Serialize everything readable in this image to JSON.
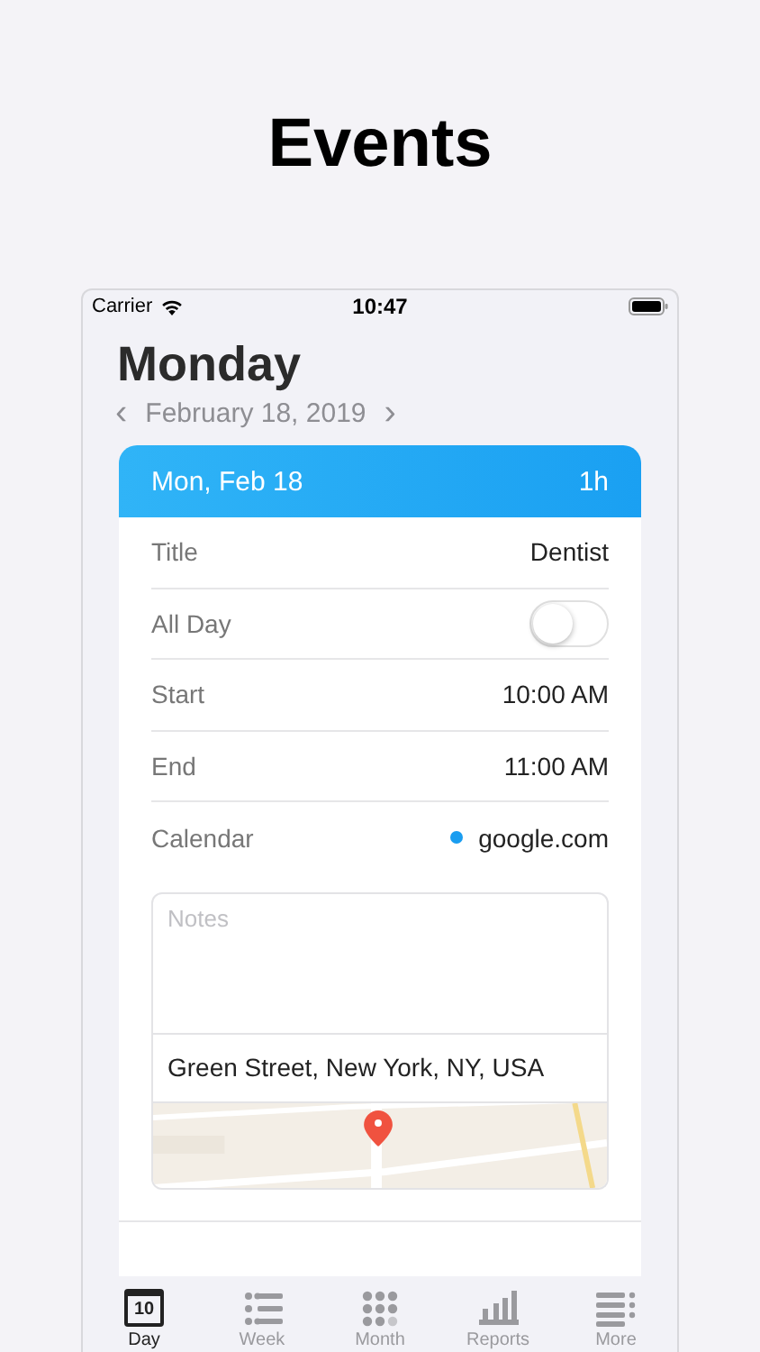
{
  "headline": "Events",
  "status_bar": {
    "carrier": "Carrier",
    "time": "10:47"
  },
  "day_title": "Monday",
  "date_nav": {
    "prev": "‹",
    "date": "February 18, 2019",
    "next": "›"
  },
  "event": {
    "header_date": "Mon, Feb 18",
    "header_duration": "1h",
    "rows": [
      {
        "kind": "text",
        "label": "Title",
        "value": "Dentist"
      },
      {
        "kind": "toggle",
        "label": "All Day",
        "on": false
      },
      {
        "kind": "text",
        "label": "Start",
        "value": "10:00 AM"
      },
      {
        "kind": "text",
        "label": "End",
        "value": "11:00 AM"
      },
      {
        "kind": "calendar",
        "label": "Calendar",
        "value": "google.com",
        "color": "#1a9df0"
      }
    ],
    "notes": {
      "placeholder": "Notes"
    },
    "location": "Green Street, New York, NY, USA"
  },
  "tabs": [
    {
      "label": "Day",
      "kind": "calendar",
      "icon_text": "10",
      "selected": true
    },
    {
      "label": "Week",
      "kind": "list",
      "selected": false
    },
    {
      "label": "Month",
      "kind": "grid",
      "selected": false
    },
    {
      "label": "Reports",
      "kind": "bars",
      "selected": false
    },
    {
      "label": "More",
      "kind": "more",
      "selected": false
    }
  ]
}
